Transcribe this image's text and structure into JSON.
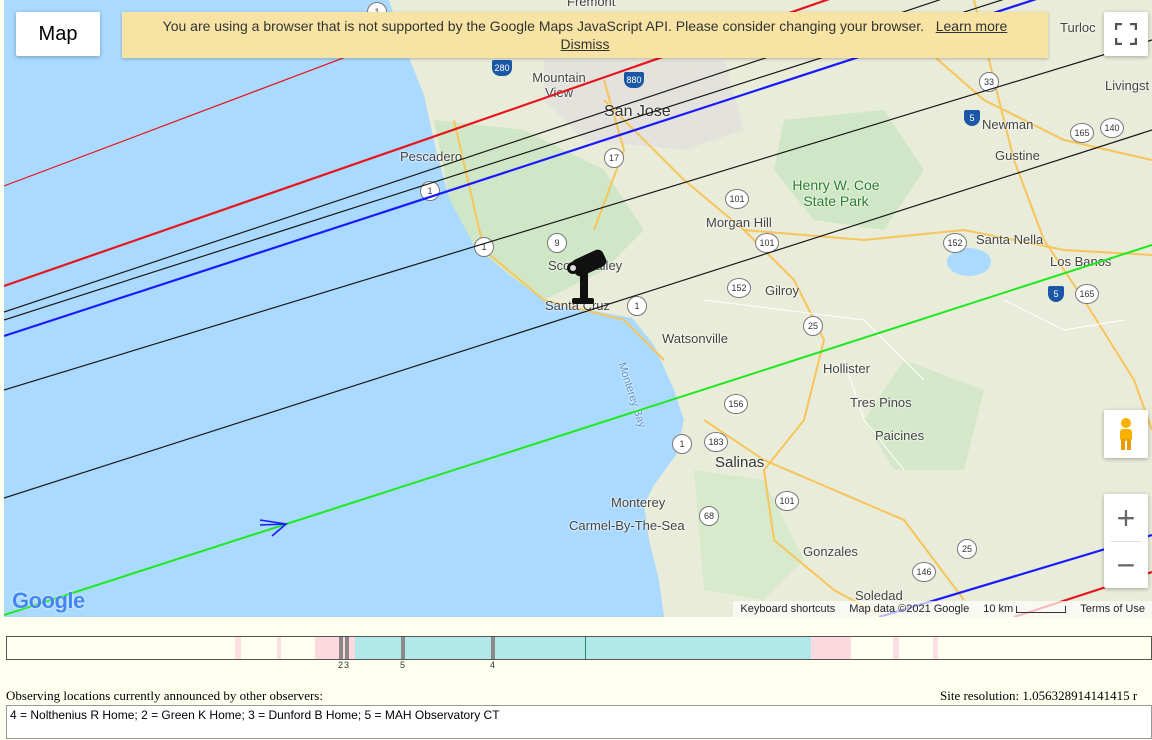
{
  "map": {
    "type_label": "Map",
    "banner": {
      "message": "You are using a browser that is not supported by the Google Maps JavaScript API. Please consider changing your browser.",
      "learn_more": "Learn more",
      "dismiss": "Dismiss"
    },
    "places": {
      "turlock": "Turloc",
      "livingston": "Livingst",
      "fremont": "Fremont",
      "mountain_view": "Mountain View",
      "san_jose": "San Jose",
      "pescadero": "Pescadero",
      "newman": "Newman",
      "gustine": "Gustine",
      "henry_coe": "Henry W. Coe State Park",
      "morgan_hill": "Morgan Hill",
      "santa_nella": "Santa Nella",
      "los_banos": "Los Banos",
      "scotts_valley": "Scotts Valley",
      "santa_cruz": "Santa Cruz",
      "gilroy": "Gilroy",
      "watsonville": "Watsonville",
      "monterey_bay": "Monterey Bay",
      "hollister": "Hollister",
      "tres_pinos": "Tres Pinos",
      "paicines": "Paicines",
      "salinas": "Salinas",
      "monterey": "Monterey",
      "carmel": "Carmel-By-The-Sea",
      "gonzales": "Gonzales",
      "soledad": "Soledad"
    },
    "shields": [
      "1",
      "280",
      "880",
      "33",
      "5",
      "165",
      "140",
      "17",
      "1",
      "101",
      "101",
      "152",
      "9",
      "1",
      "152",
      "25",
      "1",
      "183",
      "156",
      "1",
      "101",
      "68",
      "25",
      "146",
      "5",
      "165"
    ],
    "footer": {
      "shortcuts": "Keyboard shortcuts",
      "map_data": "Map data ©2021 Google",
      "scale": "10 km",
      "terms": "Terms of Use"
    },
    "controls": {
      "zoom_in": "+",
      "zoom_out": "−"
    },
    "logo": "Google",
    "path_colors": {
      "red": "#e8141c",
      "blue": "#1a1aff",
      "black": "#1a1a1a",
      "green": "#1ee81e"
    }
  },
  "timeline": {
    "tick_labels": [
      "2",
      "3",
      "5",
      "4"
    ]
  },
  "observers": {
    "label": "Observing locations currently announced by other observers:",
    "site_resolution": "Site resolution: 1.056328914141415 r",
    "list": "4 = Nolthenius R Home; 2 = Green K Home; 3 = Dunford B Home; 5 = MAH Observatory CT"
  }
}
